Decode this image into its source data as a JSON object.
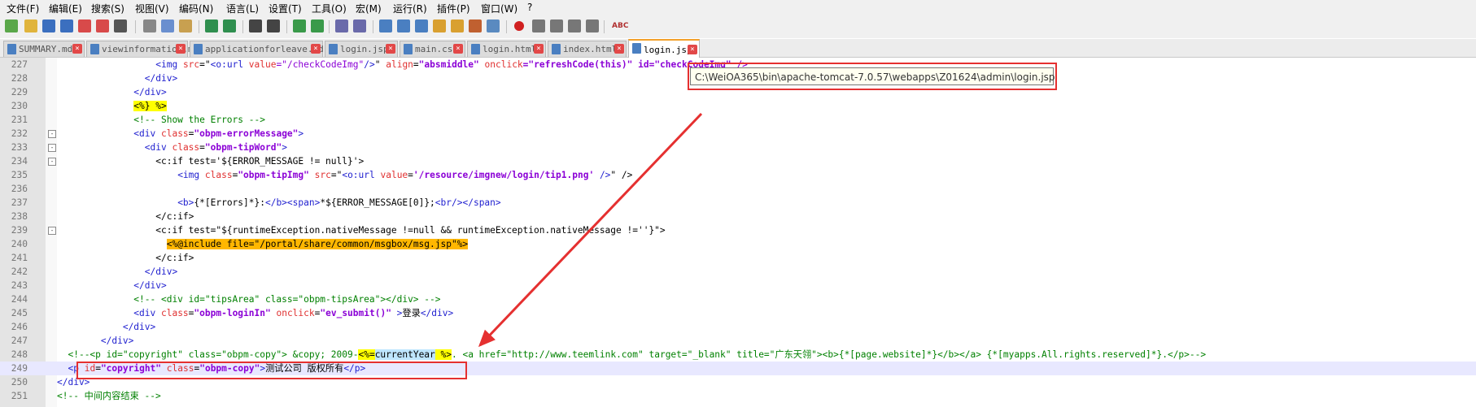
{
  "menubar": {
    "items": [
      "文件(F)",
      "编辑(E)",
      "搜索(S)",
      "视图(V)",
      "编码(N)",
      "语言(L)",
      "设置(T)",
      "工具(O)",
      "宏(M)",
      "运行(R)",
      "插件(P)",
      "窗口(W)",
      "?"
    ]
  },
  "toolbar": {
    "icons": [
      "new-file-icon",
      "open-file-icon",
      "save-icon",
      "save-all-icon",
      "close-icon",
      "close-all-icon",
      "print-icon",
      "cut-icon",
      "copy-icon",
      "paste-icon",
      "undo-icon",
      "redo-icon",
      "find-icon",
      "replace-icon",
      "zoom-in-icon",
      "zoom-out-icon",
      "sync-vertical-icon",
      "sync-horizontal-icon",
      "word-wrap-icon",
      "show-all-chars-icon",
      "indent-guide-icon",
      "doc-map-icon",
      "function-list-icon",
      "folder-workspace-icon",
      "monitoring-icon",
      "record-macro-icon",
      "stop-record-icon",
      "play-macro-icon",
      "run-macro-multiple-icon",
      "save-macro-icon",
      "spell-check-icon"
    ]
  },
  "tabs": [
    {
      "label": "SUMMARY.md",
      "active": false
    },
    {
      "label": "viewinformation.md",
      "active": false
    },
    {
      "label": "applicationforleave.md",
      "active": false
    },
    {
      "label": "login.jsp",
      "active": false
    },
    {
      "label": "main.css",
      "active": false
    },
    {
      "label": "login.html",
      "active": false
    },
    {
      "label": "index.html",
      "active": false
    },
    {
      "label": "login.jsp",
      "active": true
    }
  ],
  "tooltip": "C:\\WeiOA365\\bin\\apache-tomcat-7.0.57\\webapps\\Z01624\\admin\\login.jsp",
  "lines": [
    {
      "num": "227",
      "fold": "",
      "segs": [
        [
          "                  ",
          ""
        ],
        [
          "<img ",
          "tag"
        ],
        [
          "src",
          "attr"
        ],
        [
          "=\"",
          "txt"
        ],
        [
          "<o:url ",
          "tag"
        ],
        [
          "value",
          "attr"
        ],
        [
          "=\"/checkCodeImg\"",
          "str"
        ],
        [
          "/>",
          "tag"
        ],
        [
          "\" ",
          "txt"
        ],
        [
          "align",
          "attr"
        ],
        [
          "=",
          "txt"
        ],
        [
          "\"absmiddle\"",
          "strb"
        ],
        [
          " ",
          "txt"
        ],
        [
          "onclick",
          "attr"
        ],
        [
          "=\"refreshCode(this)\" id=\"checkCodeImg\" />",
          "strb"
        ]
      ]
    },
    {
      "num": "228",
      "fold": "",
      "segs": [
        [
          "                ",
          ""
        ],
        [
          "</div>",
          "tag"
        ]
      ]
    },
    {
      "num": "229",
      "fold": "",
      "segs": [
        [
          "              ",
          ""
        ],
        [
          "</div>",
          "tag"
        ]
      ]
    },
    {
      "num": "230",
      "fold": "",
      "segs": [
        [
          "              ",
          ""
        ],
        [
          "<%} %>",
          "jsp"
        ]
      ]
    },
    {
      "num": "231",
      "fold": "",
      "segs": [
        [
          "              ",
          ""
        ],
        [
          "<!-- Show the Errors -->",
          "cmt"
        ]
      ]
    },
    {
      "num": "232",
      "fold": "-",
      "segs": [
        [
          "              ",
          ""
        ],
        [
          "<div ",
          "tag"
        ],
        [
          "class",
          "attr"
        ],
        [
          "=",
          "txt"
        ],
        [
          "\"obpm-errorMessage\"",
          "strb"
        ],
        [
          ">",
          "tag"
        ]
      ]
    },
    {
      "num": "233",
      "fold": "-",
      "segs": [
        [
          "                ",
          ""
        ],
        [
          "<div ",
          "tag"
        ],
        [
          "class",
          "attr"
        ],
        [
          "=",
          "txt"
        ],
        [
          "\"obpm-tipWord\"",
          "strb"
        ],
        [
          ">",
          "tag"
        ]
      ]
    },
    {
      "num": "234",
      "fold": "-",
      "segs": [
        [
          "                  ",
          ""
        ],
        [
          "<c:if test='${ERROR_MESSAGE != null}'>",
          "txt"
        ]
      ]
    },
    {
      "num": "235",
      "fold": "",
      "segs": [
        [
          "                      ",
          ""
        ],
        [
          "<img ",
          "tag"
        ],
        [
          "class",
          "attr"
        ],
        [
          "=",
          "txt"
        ],
        [
          "\"obpm-tipImg\"",
          "strb"
        ],
        [
          " ",
          "txt"
        ],
        [
          "src",
          "attr"
        ],
        [
          "=\"",
          "txt"
        ],
        [
          "<o:url ",
          "tag"
        ],
        [
          "value",
          "attr"
        ],
        [
          "=",
          "txt"
        ],
        [
          "'/resource/imgnew/login/tip1.png'",
          "strb"
        ],
        [
          " />",
          "tag"
        ],
        [
          "\" />",
          "txt"
        ]
      ]
    },
    {
      "num": "236",
      "fold": "",
      "segs": [
        [
          "",
          ""
        ]
      ]
    },
    {
      "num": "237",
      "fold": "",
      "segs": [
        [
          "                      ",
          ""
        ],
        [
          "<b>",
          "tag"
        ],
        [
          "{*[Errors]*}:",
          "txt"
        ],
        [
          "</b>",
          "tag"
        ],
        [
          "<span>",
          "tag"
        ],
        [
          "*${ERROR_MESSAGE[0]};",
          "txt"
        ],
        [
          "<br/>",
          "tag"
        ],
        [
          "</span>",
          "tag"
        ]
      ]
    },
    {
      "num": "238",
      "fold": "",
      "segs": [
        [
          "                  ",
          ""
        ],
        [
          "</c:if>",
          "txt"
        ]
      ]
    },
    {
      "num": "239",
      "fold": "-",
      "segs": [
        [
          "                  ",
          ""
        ],
        [
          "<c:if test=\"${runtimeException.nativeMessage !=null && runtimeException.nativeMessage !=''}\">",
          "txt"
        ]
      ]
    },
    {
      "num": "240",
      "fold": "",
      "segs": [
        [
          "                    ",
          ""
        ],
        [
          "<%@include file=\"/portal/share/common/msgbox/msg.jsp\"%>",
          "jspb"
        ]
      ]
    },
    {
      "num": "241",
      "fold": "",
      "segs": [
        [
          "                  ",
          ""
        ],
        [
          "</c:if>",
          "txt"
        ]
      ]
    },
    {
      "num": "242",
      "fold": "",
      "segs": [
        [
          "                ",
          ""
        ],
        [
          "</div>",
          "tag"
        ]
      ]
    },
    {
      "num": "243",
      "fold": "",
      "segs": [
        [
          "              ",
          ""
        ],
        [
          "</div>",
          "tag"
        ]
      ]
    },
    {
      "num": "244",
      "fold": "",
      "segs": [
        [
          "              ",
          ""
        ],
        [
          "<!-- <div id=\"tipsArea\" class=\"obpm-tipsArea\"></div> -->",
          "cmt"
        ]
      ]
    },
    {
      "num": "245",
      "fold": "",
      "segs": [
        [
          "              ",
          ""
        ],
        [
          "<div ",
          "tag"
        ],
        [
          "class",
          "attr"
        ],
        [
          "=",
          "txt"
        ],
        [
          "\"obpm-loginIn\"",
          "strb"
        ],
        [
          " ",
          "txt"
        ],
        [
          "onclick",
          "attr"
        ],
        [
          "=",
          "txt"
        ],
        [
          "\"ev_submit()\"",
          "strb"
        ],
        [
          " >",
          "tag"
        ],
        [
          "登录",
          "txt"
        ],
        [
          "</div>",
          "tag"
        ]
      ]
    },
    {
      "num": "246",
      "fold": "",
      "segs": [
        [
          "            ",
          ""
        ],
        [
          "</div>",
          "tag"
        ]
      ]
    },
    {
      "num": "247",
      "fold": "",
      "segs": [
        [
          "        ",
          ""
        ],
        [
          "</div>",
          "tag"
        ]
      ]
    },
    {
      "num": "248",
      "fold": "",
      "segs": [
        [
          "  ",
          ""
        ],
        [
          "<!--<p id=\"copyright\" class=\"obpm-copy\"> &copy; 2009-",
          "cmt"
        ],
        [
          "<%=",
          "jsp"
        ],
        [
          "currentYear",
          "jspv"
        ],
        [
          " %>",
          "jsp"
        ],
        [
          ". <a href=\"",
          "cmt"
        ],
        [
          "http://www.teemlink.com",
          "cmt"
        ],
        [
          "\" target=\"_blank\" title=\"广东天翎\"><b>{*[page.website]*}</b></a> {*[myapps.All.rights.reserved]*}.</p>-->",
          "cmt"
        ]
      ]
    },
    {
      "num": "249",
      "fold": "",
      "current": true,
      "segs": [
        [
          "  ",
          ""
        ],
        [
          "<p ",
          "tag"
        ],
        [
          "id",
          "attr"
        ],
        [
          "=",
          "txt"
        ],
        [
          "\"copyright\"",
          "strb"
        ],
        [
          " ",
          "txt"
        ],
        [
          "class",
          "attr"
        ],
        [
          "=",
          "txt"
        ],
        [
          "\"obpm-copy\"",
          "strb"
        ],
        [
          ">",
          "tag"
        ],
        [
          "测试公司 版权所有",
          "txt"
        ],
        [
          "</p>",
          "tag"
        ]
      ]
    },
    {
      "num": "250",
      "fold": "",
      "segs": [
        [
          "",
          ""
        ],
        [
          "</div>",
          "tag"
        ]
      ]
    },
    {
      "num": "251",
      "fold": "",
      "segs": [
        [
          "",
          ""
        ],
        [
          "<!-- 中间内容结束 -->",
          "cmt"
        ]
      ]
    }
  ]
}
